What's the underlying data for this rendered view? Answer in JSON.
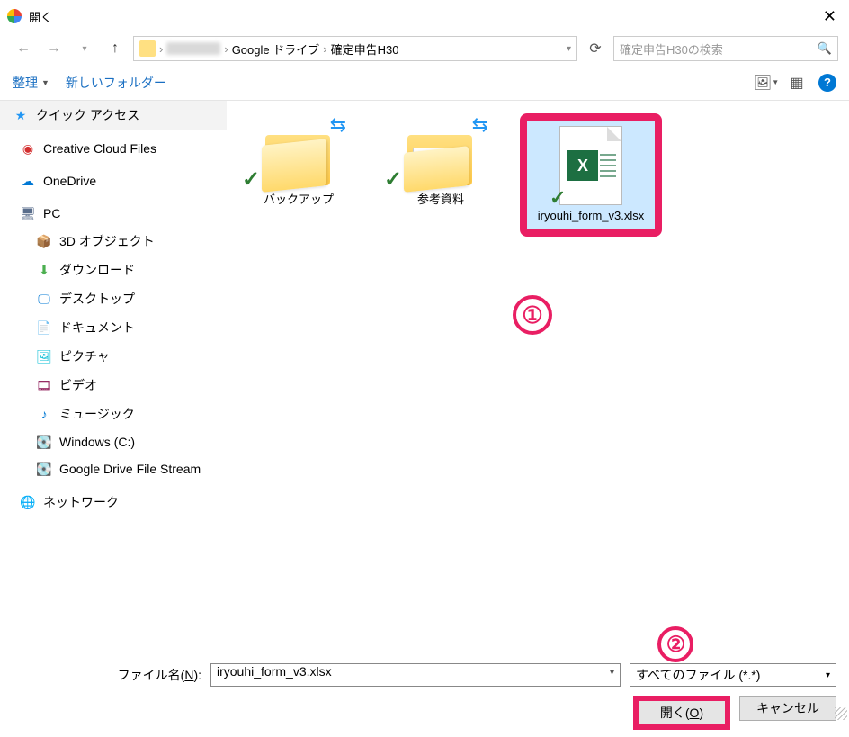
{
  "title": "開く",
  "nav": {
    "blur_segment": true
  },
  "breadcrumb": {
    "seg1": "Google ドライブ",
    "seg2": "確定申告H30"
  },
  "search": {
    "placeholder": "確定申告H30の検索"
  },
  "toolbar": {
    "organize": "整理",
    "newfolder": "新しいフォルダー"
  },
  "sidebar": {
    "quick": "クイック アクセス",
    "cc": "Creative Cloud Files",
    "onedrive": "OneDrive",
    "pc": "PC",
    "obj3d": "3D オブジェクト",
    "downloads": "ダウンロード",
    "desktop": "デスクトップ",
    "documents": "ドキュメント",
    "pictures": "ピクチャ",
    "videos": "ビデオ",
    "music": "ミュージック",
    "cdrive": "Windows (C:)",
    "gdrive": "Google Drive File Stream",
    "network": "ネットワーク"
  },
  "files": {
    "backup": "バックアップ",
    "refs": "参考資料",
    "xlsx": "iryouhi_form_v3.xlsx"
  },
  "callouts": {
    "one": "①",
    "two": "②"
  },
  "footer": {
    "fname_label_pre": "ファイル名(",
    "fname_label_u": "N",
    "fname_label_post": "):",
    "fname_value": "iryouhi_form_v3.xlsx",
    "type_pre": "すべて",
    "type_mid": "ァイル (*.*)",
    "open_pre": "開く(",
    "open_u": "O",
    "open_post": ")",
    "cancel": "キャンセル"
  }
}
